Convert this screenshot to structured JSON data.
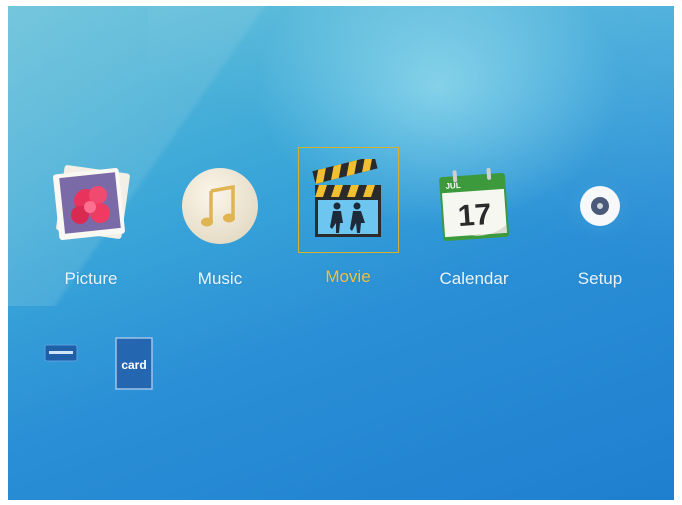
{
  "menu": {
    "items": [
      {
        "label": "Picture",
        "icon": "photo-stack-icon"
      },
      {
        "label": "Music",
        "icon": "music-note-icon"
      },
      {
        "label": "Movie",
        "icon": "clapperboard-icon"
      },
      {
        "label": "Calendar",
        "icon": "calendar-icon"
      },
      {
        "label": "Setup",
        "icon": "settings-disc-icon"
      }
    ],
    "selected": "Movie"
  },
  "calendar_icon": {
    "month": "JUL",
    "day": "17"
  },
  "devices": {
    "card_label": "card"
  },
  "colors": {
    "label": "#e8f4fb",
    "selected_label": "#f0c040",
    "selection_frame": "#d8b030",
    "background_top": "#5fc0d8",
    "background_bottom": "#1f7fd0"
  }
}
